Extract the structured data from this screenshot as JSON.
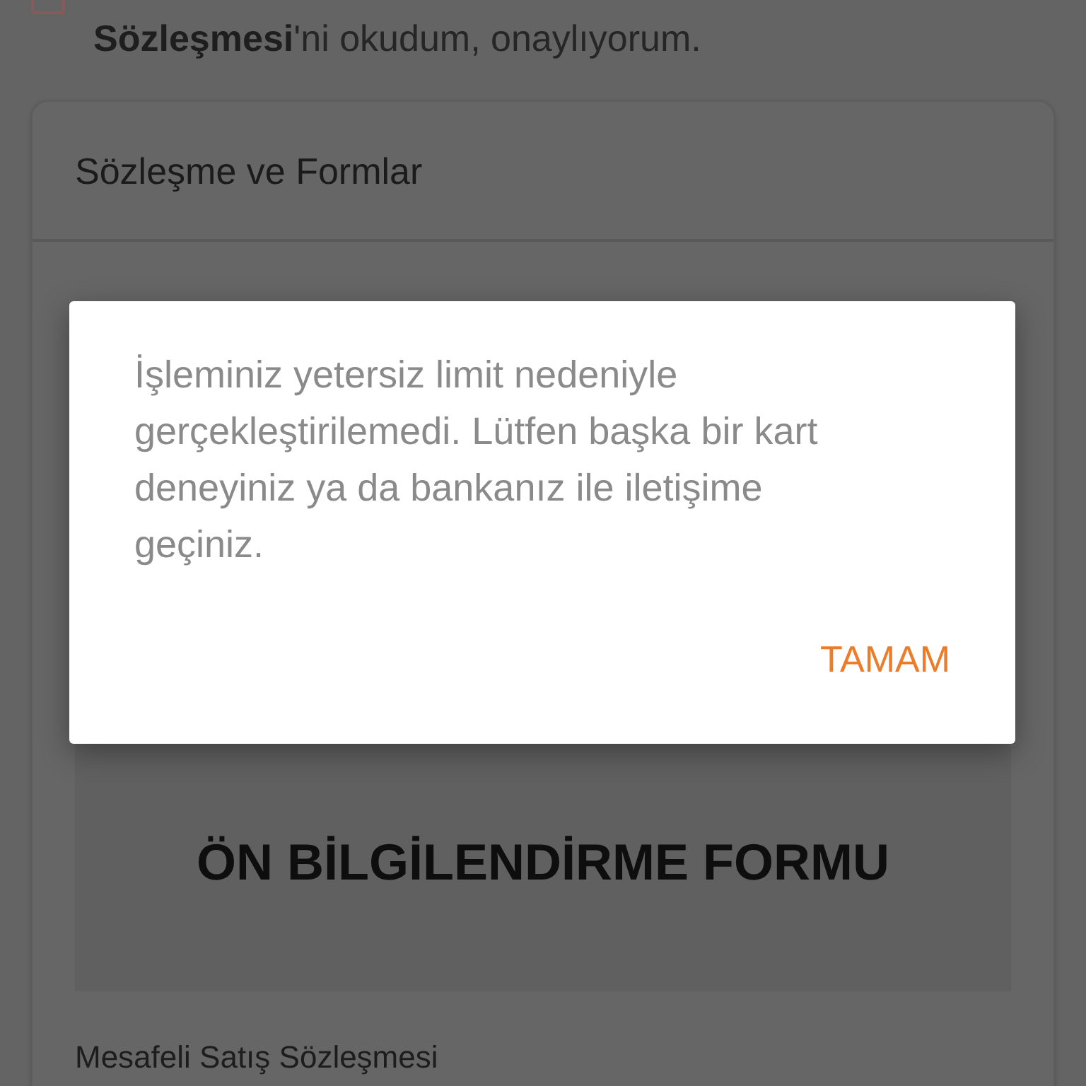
{
  "consent": {
    "checked": false,
    "text": "**Sözleşmesi**'ni okudum, onaylıyorum."
  },
  "contracts": {
    "title": "Sözleşme ve Formlar",
    "document": {
      "title": "ÖN BİLGİLENDİRME FORMU"
    },
    "next_item": "Mesafeli Satış Sözleşmesi"
  },
  "dialog": {
    "message": "İşleminiz yetersiz limit nedeniyle gerçekleştirilemedi. Lütfen başka bir kart deneyiniz ya da bankanız ile iletişime geçiniz.",
    "button": "TAMAM"
  }
}
